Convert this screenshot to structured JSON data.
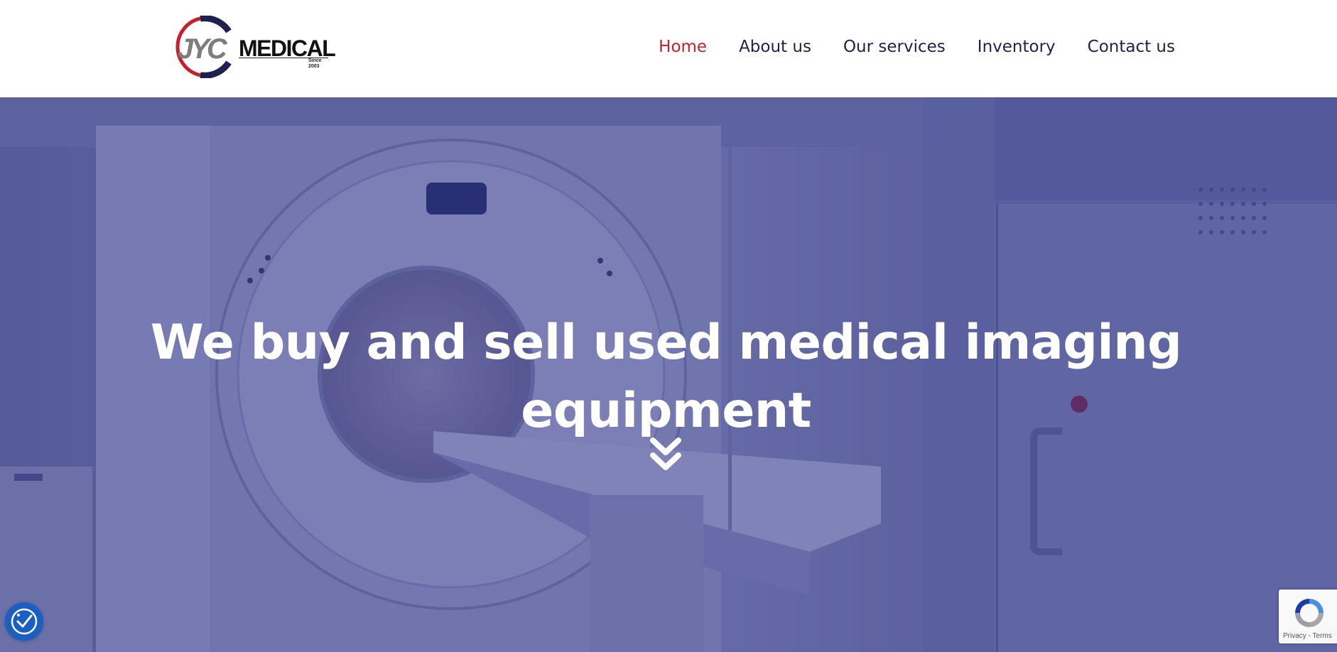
{
  "logo": {
    "mark": "JYC",
    "word": "MEDICAL",
    "since": "Since 2003",
    "colors": {
      "ring_red": "#c8202b",
      "ring_navy": "#1d2150",
      "mark_gray": "#7d7d7d"
    }
  },
  "nav": {
    "items": [
      {
        "label": "Home",
        "active": true
      },
      {
        "label": "About us",
        "active": false
      },
      {
        "label": "Our services",
        "active": false
      },
      {
        "label": "Inventory",
        "active": false
      },
      {
        "label": "Contact us",
        "active": false
      }
    ],
    "colors": {
      "text": "#1d2150",
      "active": "#c8202b"
    }
  },
  "hero": {
    "title": "We buy and sell used medical imaging equipment",
    "scroll_icon": "double-chevron-down-icon",
    "overlay_color": "#262d78"
  },
  "accessibility": {
    "icon": "accessibility-icon",
    "color": "#1b5fc4"
  },
  "recaptcha": {
    "icon": "recaptcha-icon",
    "privacy": "Privacy",
    "separator": " - ",
    "terms": "Terms"
  }
}
